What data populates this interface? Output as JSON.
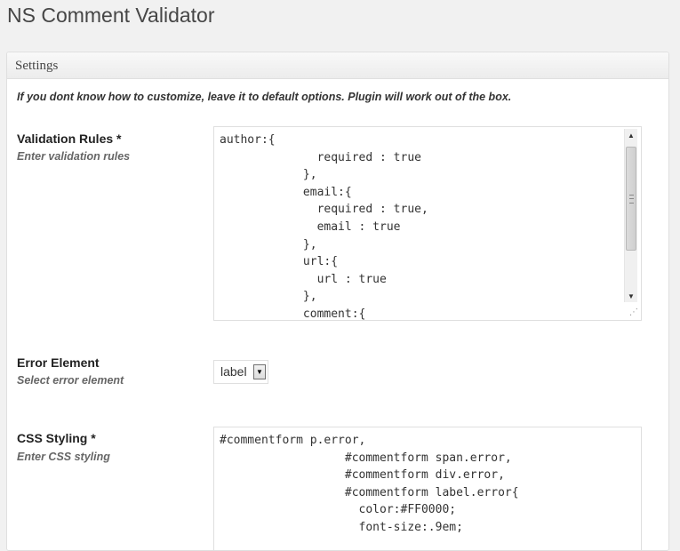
{
  "page": {
    "title": "NS Comment Validator"
  },
  "settings_box": {
    "title": "Settings",
    "intro": "If you dont know how to customize, leave it to default options. Plugin will work out of the box."
  },
  "fields": {
    "validation_rules": {
      "label": "Validation Rules *",
      "description": "Enter validation rules",
      "value": "author:{\n              required : true\n            },\n            email:{\n              required : true,\n              email : true\n            },\n            url:{\n              url : true\n            },\n            comment:{"
    },
    "error_element": {
      "label": "Error Element",
      "description": "Select error element",
      "selected": "label"
    },
    "css_styling": {
      "label": "CSS Styling *",
      "description": "Enter CSS styling",
      "value": "#commentform p.error,\n                  #commentform span.error,\n                  #commentform div.error,\n                  #commentform label.error{\n                    color:#FF0000;\n                    font-size:.9em;"
    }
  },
  "icons": {
    "scroll_up": "scroll-up-arrow-icon",
    "scroll_down": "scroll-down-arrow-icon",
    "select_dropdown": "chevron-down-icon",
    "resize": "resize-grip-icon"
  }
}
